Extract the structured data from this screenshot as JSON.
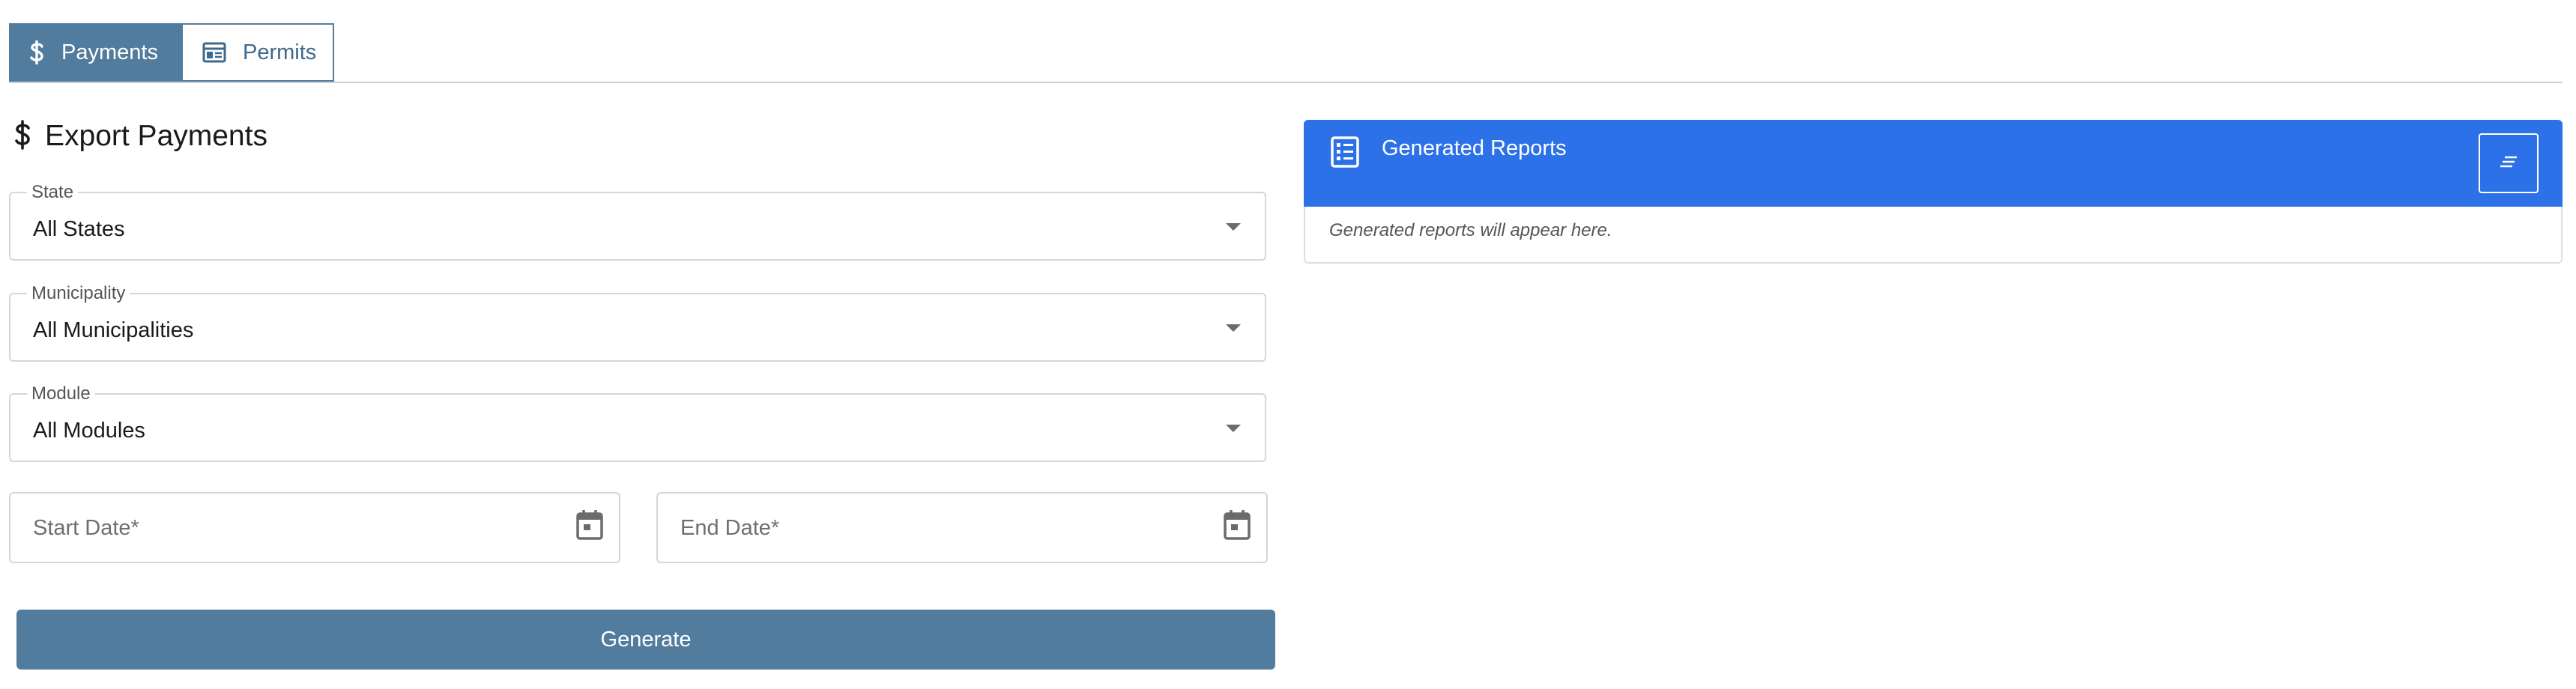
{
  "tabs": [
    {
      "label": "Payments",
      "icon": "dollar-icon",
      "active": true
    },
    {
      "label": "Permits",
      "icon": "calendar-table-icon",
      "active": false
    }
  ],
  "section": {
    "title": "Export Payments",
    "icon": "dollar-icon"
  },
  "form": {
    "state": {
      "label": "State",
      "value": "All States"
    },
    "municipality": {
      "label": "Municipality",
      "value": "All Municipalities"
    },
    "module": {
      "label": "Module",
      "value": "All Modules"
    },
    "start_date": {
      "placeholder": "Start Date*"
    },
    "end_date": {
      "placeholder": "End Date*"
    },
    "generate_label": "Generate"
  },
  "reports": {
    "title": "Generated Reports",
    "icon": "list-icon",
    "action_icon": "sort-lines-icon",
    "empty_text": "Generated reports will appear here."
  },
  "colors": {
    "primary": "#527c9d",
    "header_blue": "#2c71e8",
    "border": "#d3d6da"
  }
}
